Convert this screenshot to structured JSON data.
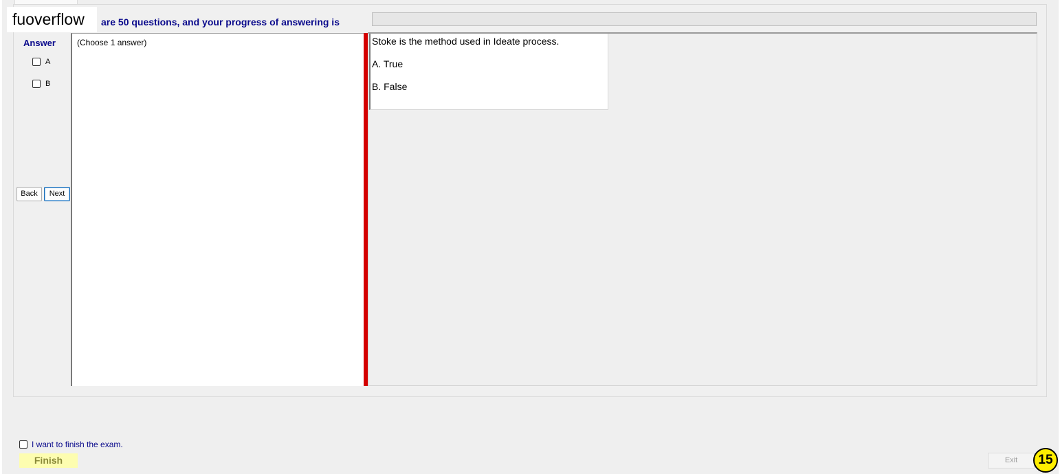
{
  "watermark": "fuoverflow",
  "progress": {
    "label": "are 50 questions, and your progress of answering is",
    "value": 0
  },
  "answer": {
    "heading": "Answer",
    "options": [
      "A",
      "B"
    ],
    "hint": "(Choose 1 answer)"
  },
  "nav": {
    "back_label": "Back",
    "next_label": "Next"
  },
  "question": {
    "text": "Stoke is the method used in Ideate process.",
    "choices": [
      "A.  True",
      "B.  False"
    ]
  },
  "footer": {
    "finish_check_label": "I want to finish the exam.",
    "finish_label": "Finish",
    "exit_label": "Exit",
    "badge": "15"
  },
  "colors": {
    "accent_text": "#0a0a8c",
    "splitter": "#d40000",
    "badge": "#ffee00",
    "finish_bg": "#fdfdb0"
  }
}
